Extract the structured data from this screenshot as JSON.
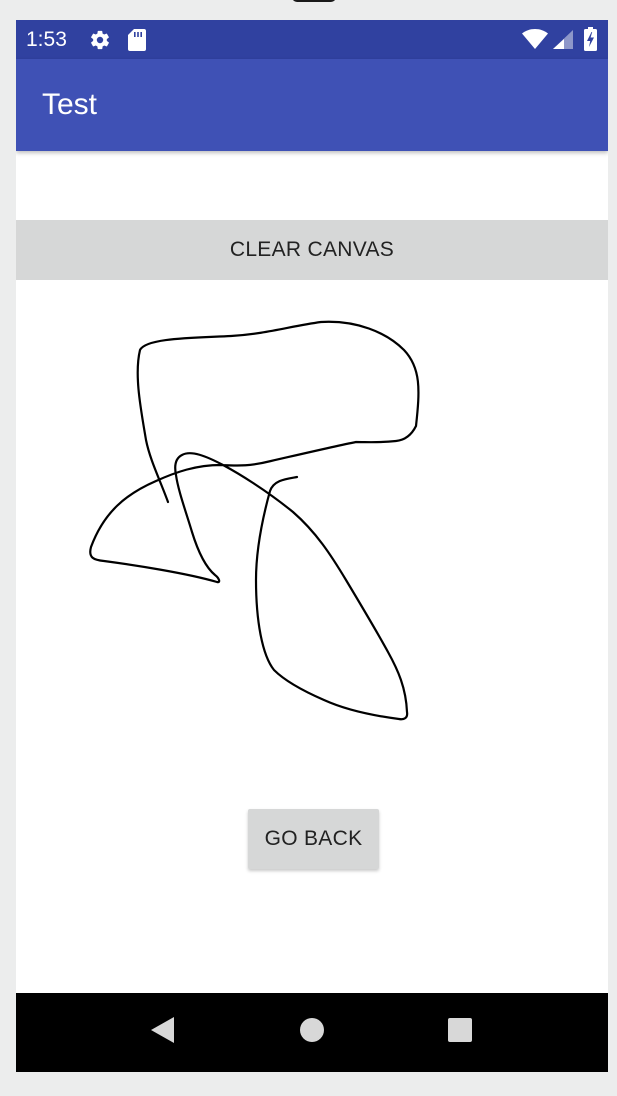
{
  "status_bar": {
    "time": "1:53",
    "icons": [
      "gear-icon",
      "sd-card-icon",
      "wifi-icon",
      "cell-signal-icon",
      "battery-charging-icon"
    ],
    "background": "#3041a0"
  },
  "app_bar": {
    "title": "Test",
    "background": "#3f51b5"
  },
  "main": {
    "clear_button_label": "CLEAR CANVAS",
    "go_back_button_label": "GO BACK",
    "button_background": "#d6d7d7"
  },
  "nav_bar": {
    "items": [
      {
        "name": "back",
        "icon": "triangle-back-icon"
      },
      {
        "name": "home",
        "icon": "circle-home-icon"
      },
      {
        "name": "recents",
        "icon": "square-recents-icon"
      }
    ]
  }
}
